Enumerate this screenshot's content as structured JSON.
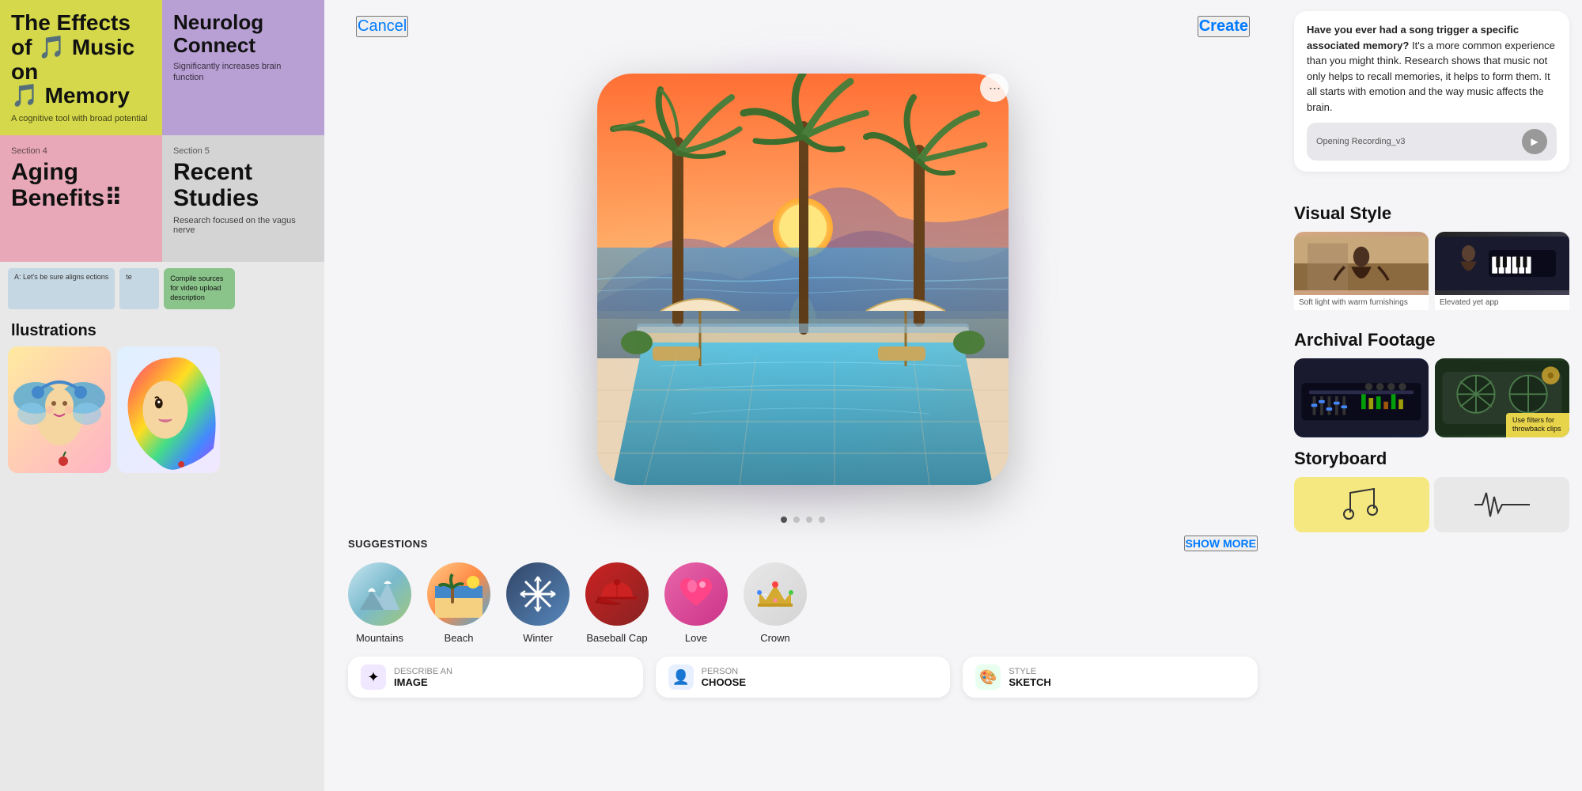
{
  "left": {
    "card1": {
      "title": "The Effects of 🎵 Music on 🎵 Memory",
      "subtitle": "A cognitive tool with broad potential"
    },
    "card2": {
      "title": "Neurolog Connect",
      "subtitle": "Significantly increases brain function"
    },
    "section4_label": "Section 4",
    "section4_title": "Aging Benefits⠿",
    "section5_label": "Section 5",
    "section5_title": "Recent Studies",
    "section5_desc": "Research focused on the vagus nerve",
    "sticky1": "A: Let's be sure aligns ections",
    "sticky2": "te",
    "sticky_green": "Compile sources for video upload description",
    "illustrations_label": "llustrations"
  },
  "center": {
    "cancel_label": "Cancel",
    "create_label": "Create",
    "more_icon": "···",
    "dots": [
      true,
      false,
      false,
      false
    ],
    "suggestions_label": "SUGGESTIONS",
    "show_more_label": "SHOW MORE",
    "suggestions": [
      {
        "id": "mountains",
        "label": "Mountains",
        "emoji": "🏔"
      },
      {
        "id": "beach",
        "label": "Beach",
        "emoji": "🏖"
      },
      {
        "id": "winter",
        "label": "Winter",
        "emoji": "❄"
      },
      {
        "id": "baseball-cap",
        "label": "Baseball Cap",
        "emoji": "🧢"
      },
      {
        "id": "love",
        "label": "Love",
        "emoji": "💗"
      },
      {
        "id": "crown",
        "label": "Crown",
        "emoji": "👑"
      }
    ],
    "tools": [
      {
        "id": "describe",
        "title": "DESCRIBE AN",
        "value": "IMAGE",
        "icon": "✦"
      },
      {
        "id": "person",
        "title": "PERSON",
        "value": "CHOOSE",
        "icon": "👤"
      },
      {
        "id": "style",
        "title": "STYLE",
        "value": "SKETCH",
        "icon": "🎨"
      }
    ]
  },
  "right": {
    "chat_text_bold": "Have you ever had a song trigger a specific associated memory?",
    "chat_text_rest": " It's a more common experience than you might think. Research shows that music not only helps to recall memories, it helps to form them. It all starts with emotion and the way music affects the brain.",
    "audio_title": "Opening Recording_v3",
    "visual_style_heading": "Visual Style",
    "vs_items": [
      {
        "label": "Soft light with warm furnishings"
      },
      {
        "label": "Elevated yet app"
      }
    ],
    "archival_heading": "Archival Footage",
    "archival_overlay": "Use filters for throwback clips",
    "storyboard_heading": "Storyboard"
  }
}
